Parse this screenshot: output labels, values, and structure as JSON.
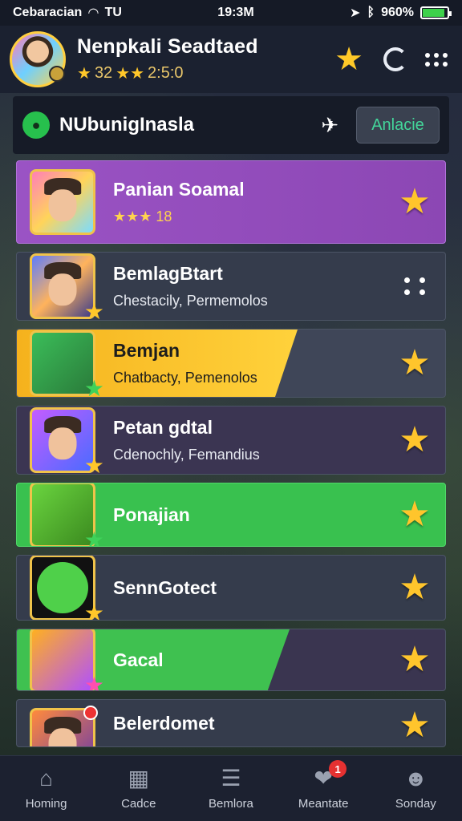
{
  "status_bar": {
    "carrier": "Cebaracian",
    "network": "TU",
    "time": "19:3M",
    "battery": "960%",
    "battery_level": 0.85
  },
  "header": {
    "name": "Nenpkali Seadtaed",
    "rating_prefix": "32",
    "score": "2:5:0"
  },
  "section": {
    "title": "NUbunigInasla",
    "button_label": "Anlacie"
  },
  "rows": [
    {
      "title": "Panian Soamal",
      "subtitle": "★★★ 18"
    },
    {
      "title": "BemlagBtart",
      "subtitle": "Chestacily, Permemolos"
    },
    {
      "title": "Bemjan",
      "subtitle": "Chatbacty, Pemenolos"
    },
    {
      "title": "Petan gdtal",
      "subtitle": "Cdenochly, Femandius"
    },
    {
      "title": "Ponajian",
      "subtitle": ""
    },
    {
      "title": "SennGotect",
      "subtitle": ""
    },
    {
      "title": "Gacal",
      "subtitle": ""
    },
    {
      "title": "Belerdomet",
      "subtitle": ""
    }
  ],
  "tabs": [
    {
      "label": "Homing",
      "icon": "home-icon"
    },
    {
      "label": "Cadce",
      "icon": "games-icon"
    },
    {
      "label": "Bemlora",
      "icon": "list-icon"
    },
    {
      "label": "Meantate",
      "icon": "chat-icon",
      "badge": "1"
    },
    {
      "label": "Sonday",
      "icon": "profile-icon"
    }
  ],
  "colors": {
    "accent_gold": "#ffc72a",
    "green": "#39c14f",
    "purple": "#9a53c4",
    "yellow": "#f5b21d"
  }
}
